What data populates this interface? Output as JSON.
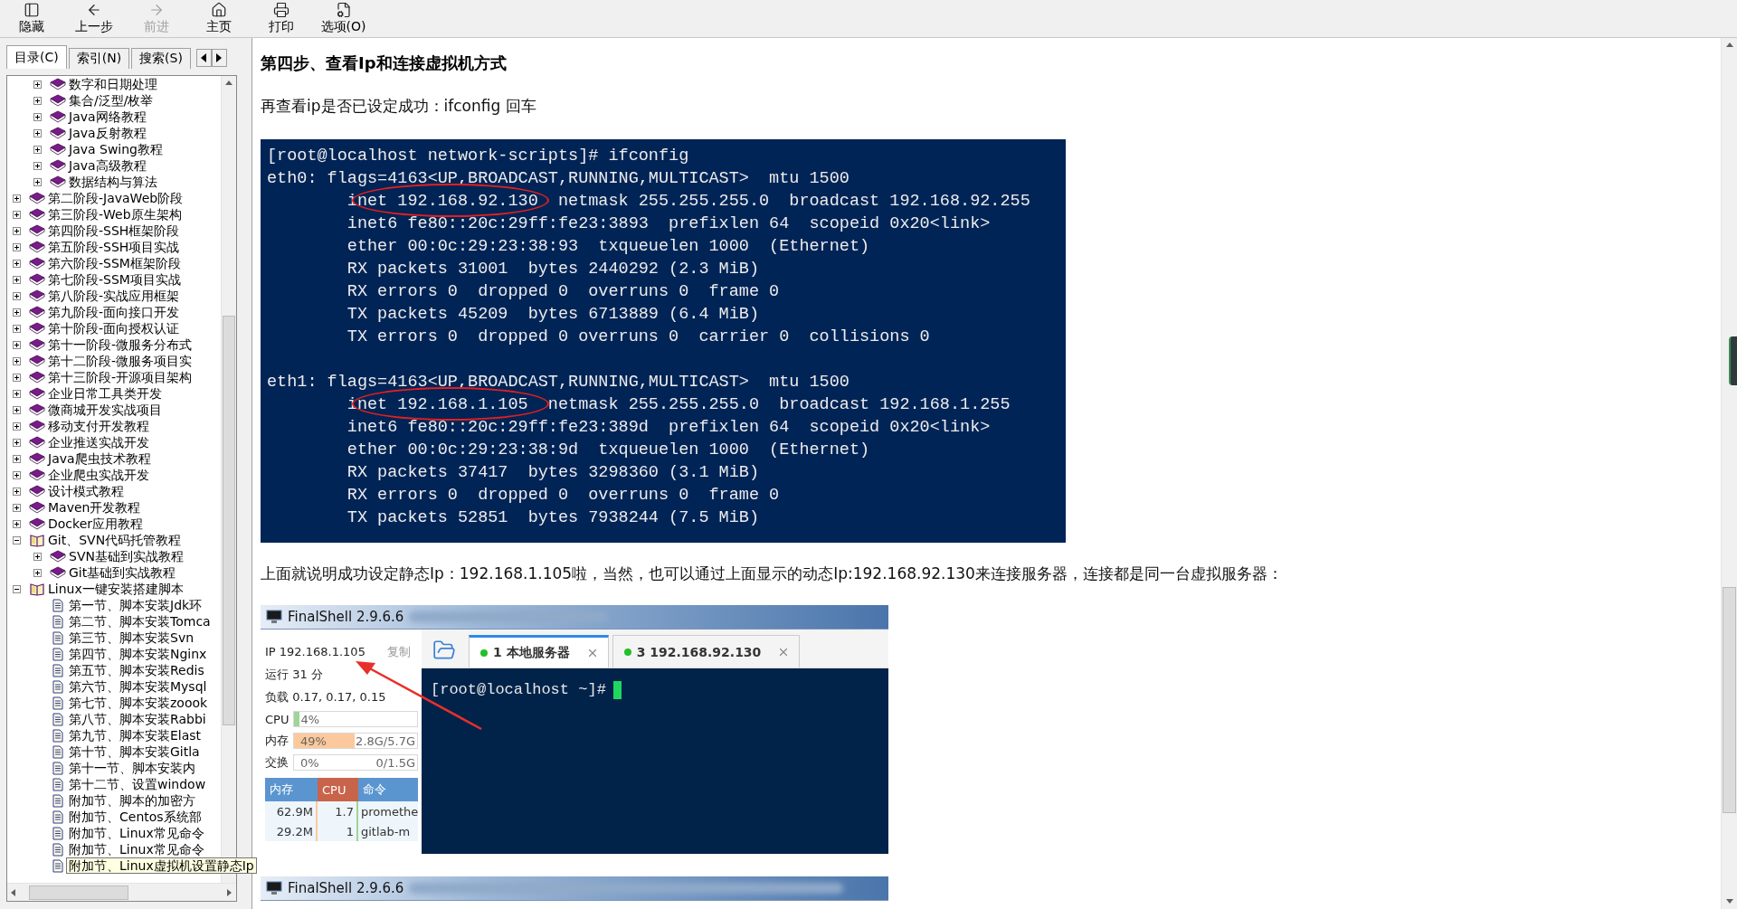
{
  "toolbar": [
    {
      "label": "隐藏",
      "kind": "panel",
      "disabled": false
    },
    {
      "label": "上一步",
      "kind": "back",
      "disabled": false
    },
    {
      "label": "前进",
      "kind": "forward",
      "disabled": true
    },
    {
      "label": "主页",
      "kind": "home",
      "disabled": false
    },
    {
      "label": "打印",
      "kind": "print",
      "disabled": false
    },
    {
      "label": "选项(O)",
      "kind": "options",
      "disabled": false
    }
  ],
  "nav_tabs": [
    {
      "label": "目录(C)",
      "selected": true
    },
    {
      "label": "索引(N)",
      "selected": false
    },
    {
      "label": "搜索(S)",
      "selected": false
    }
  ],
  "tree": {
    "partial_children": [
      {
        "label": "数字和日期处理",
        "kind": "book",
        "expanded": false
      },
      {
        "label": "集合/泛型/枚举",
        "kind": "book",
        "expanded": false
      },
      {
        "label": "Java网络教程",
        "kind": "book",
        "expanded": false
      },
      {
        "label": "Java反射教程",
        "kind": "book",
        "expanded": false
      },
      {
        "label": "Java Swing教程",
        "kind": "book",
        "expanded": false
      },
      {
        "label": "Java高级教程",
        "kind": "book",
        "expanded": false
      },
      {
        "label": "数据结构与算法",
        "kind": "book",
        "expanded": false
      }
    ],
    "items": [
      {
        "label": "第二阶段-JavaWeb阶段",
        "kind": "book",
        "expanded": false
      },
      {
        "label": "第三阶段-Web原生架构",
        "kind": "book",
        "expanded": false
      },
      {
        "label": "第四阶段-SSH框架阶段",
        "kind": "book",
        "expanded": false
      },
      {
        "label": "第五阶段-SSH项目实战",
        "kind": "book",
        "expanded": false
      },
      {
        "label": "第六阶段-SSM框架阶段",
        "kind": "book",
        "expanded": false
      },
      {
        "label": "第七阶段-SSM项目实战",
        "kind": "book",
        "expanded": false
      },
      {
        "label": "第八阶段-实战应用框架",
        "kind": "book",
        "expanded": false
      },
      {
        "label": "第九阶段-面向接口开发",
        "kind": "book",
        "expanded": false
      },
      {
        "label": "第十阶段-面向授权认证",
        "kind": "book",
        "expanded": false
      },
      {
        "label": "第十一阶段-微服务分布式",
        "kind": "book",
        "expanded": false
      },
      {
        "label": "第十二阶段-微服务项目实",
        "kind": "book",
        "expanded": false
      },
      {
        "label": "第十三阶段-开源项目架构",
        "kind": "book",
        "expanded": false
      },
      {
        "label": "企业日常工具类开发",
        "kind": "book",
        "expanded": false
      },
      {
        "label": "微商城开发实战项目",
        "kind": "book",
        "expanded": false
      },
      {
        "label": "移动支付开发教程",
        "kind": "book",
        "expanded": false
      },
      {
        "label": "企业推送实战开发",
        "kind": "book",
        "expanded": false
      },
      {
        "label": "Java爬虫技术教程",
        "kind": "book",
        "expanded": false
      },
      {
        "label": "企业爬虫实战开发",
        "kind": "book",
        "expanded": false
      },
      {
        "label": "设计模式教程",
        "kind": "book",
        "expanded": false
      },
      {
        "label": "Maven开发教程",
        "kind": "book",
        "expanded": false
      },
      {
        "label": "Docker应用教程",
        "kind": "book",
        "expanded": false
      },
      {
        "label": "Git、SVN代码托管教程",
        "kind": "book",
        "expanded": true,
        "children": [
          {
            "label": "SVN基础到实战教程",
            "kind": "book",
            "expanded": false
          },
          {
            "label": "Git基础到实战教程",
            "kind": "book",
            "expanded": false
          }
        ]
      },
      {
        "label": "Linux一键安装搭建脚本",
        "kind": "book",
        "expanded": true,
        "children": [
          {
            "label": "第一节、脚本安装Jdk环",
            "kind": "page",
            "hovered": false
          },
          {
            "label": "第二节、脚本安装Tomca",
            "kind": "page",
            "hovered": false
          },
          {
            "label": "第三节、脚本安装Svn",
            "kind": "page",
            "hovered": false
          },
          {
            "label": "第四节、脚本安装Nginx",
            "kind": "page",
            "hovered": false
          },
          {
            "label": "第五节、脚本安装Redis",
            "kind": "page",
            "hovered": false
          },
          {
            "label": "第六节、脚本安装Mysql",
            "kind": "page",
            "hovered": false
          },
          {
            "label": "第七节、脚本安装zoook",
            "kind": "page",
            "hovered": false
          },
          {
            "label": "第八节、脚本安装Rabbi",
            "kind": "page",
            "hovered": false
          },
          {
            "label": "第九节、脚本安装Elast",
            "kind": "page",
            "hovered": false
          },
          {
            "label": "第十节、脚本安装Gitla",
            "kind": "page",
            "hovered": false
          },
          {
            "label": "第十一节、脚本安装内",
            "kind": "page",
            "hovered": false
          },
          {
            "label": "第十二节、设置window",
            "kind": "page",
            "hovered": false
          },
          {
            "label": "附加节、脚本的加密方",
            "kind": "page",
            "hovered": false
          },
          {
            "label": "附加节、Centos系统部",
            "kind": "page",
            "hovered": false
          },
          {
            "label": "附加节、Linux常见命令",
            "kind": "page",
            "hovered": false
          },
          {
            "label": "附加节、Linux常见命令",
            "kind": "page",
            "hovered": false
          },
          {
            "label": "附加节、Linux虚拟机设置静态Ip",
            "kind": "page",
            "hovered": true
          }
        ]
      }
    ]
  },
  "content": {
    "heading": "第四步、查看Ip和连接虚拟机方式",
    "intro": "再查看ip是否已设定成功：ifconfig 回车",
    "terminal": {
      "blocks": [
        {
          "lines": [
            {
              "text": "[root@localhost network-scripts]# ifconfig",
              "circled": false
            },
            {
              "text": "eth0: flags=4163<UP,BROADCAST,RUNNING,MULTICAST>  mtu 1500",
              "circled": false
            },
            {
              "text": "        inet 192.168.92.130  netmask 255.255.255.0  broadcast 192.168.92.255",
              "circled": true
            },
            {
              "text": "        inet6 fe80::20c:29ff:fe23:3893  prefixlen 64  scopeid 0x20<link>",
              "circled": false
            },
            {
              "text": "        ether 00:0c:29:23:38:93  txqueuelen 1000  (Ethernet)",
              "circled": false
            },
            {
              "text": "        RX packets 31001  bytes 2440292 (2.3 MiB)",
              "circled": false
            },
            {
              "text": "        RX errors 0  dropped 0  overruns 0  frame 0",
              "circled": false
            },
            {
              "text": "        TX packets 45209  bytes 6713889 (6.4 MiB)",
              "circled": false
            },
            {
              "text": "        TX errors 0  dropped 0 overruns 0  carrier 0  collisions 0",
              "circled": false
            }
          ]
        },
        {
          "lines": [
            {
              "text": "eth1: flags=4163<UP,BROADCAST,RUNNING,MULTICAST>  mtu 1500",
              "circled": false
            },
            {
              "text": "        inet 192.168.1.105  netmask 255.255.255.0  broadcast 192.168.1.255",
              "circled": true
            },
            {
              "text": "        inet6 fe80::20c:29ff:fe23:389d  prefixlen 64  scopeid 0x20<link>",
              "circled": false
            },
            {
              "text": "        ether 00:0c:29:23:38:9d  txqueuelen 1000  (Ethernet)",
              "circled": false
            },
            {
              "text": "        RX packets 37417  bytes 3298360 (3.1 MiB)",
              "circled": false
            },
            {
              "text": "        RX errors 0  dropped 0  overruns 0  frame 0",
              "circled": false
            },
            {
              "text": "        TX packets 52851  bytes 7938244 (7.5 MiB)",
              "circled": false
            }
          ]
        }
      ]
    },
    "note": "上面就说明成功设定静态Ip：192.168.1.105啦，当然，也可以通过上面显示的动态Ip:192.168.92.130来连接服务器，连接都是同一台虚拟服务器：",
    "finalshell": {
      "title": "FinalShell 2.9.6.6",
      "ip": "IP 192.168.1.105",
      "copy": "复制",
      "uptime": "运行 31 分",
      "load": "负载 0.17, 0.17, 0.15",
      "meters": [
        {
          "label": "CPU",
          "value": "4%",
          "level": 0.04,
          "color": "#9fd49a"
        },
        {
          "label": "内存",
          "value": "49%",
          "total": "2.8G/5.7G",
          "level": 0.49,
          "color": "#fbc99b"
        },
        {
          "label": "交换",
          "value": "0%",
          "total": "0/1.5G",
          "level": 0
        }
      ],
      "process_columns": [
        {
          "label": "内存",
          "selected": false
        },
        {
          "label": "CPU",
          "selected": true
        },
        {
          "label": "命令",
          "selected": false
        }
      ],
      "processes": [
        {
          "mem": "62.9M",
          "cpu": "1.7",
          "command": "promethe"
        },
        {
          "mem": "29.2M",
          "cpu": "1",
          "command": "gitlab-m"
        }
      ],
      "tabs": [
        {
          "label": "1 本地服务器",
          "selected": true,
          "connected": true
        },
        {
          "label": "3 192.168.92.130",
          "selected": false,
          "connected": true
        }
      ],
      "prompt": "[root@localhost ~]#"
    },
    "finalshell_2": {
      "title": "FinalShell 2.9.6.6"
    }
  }
}
